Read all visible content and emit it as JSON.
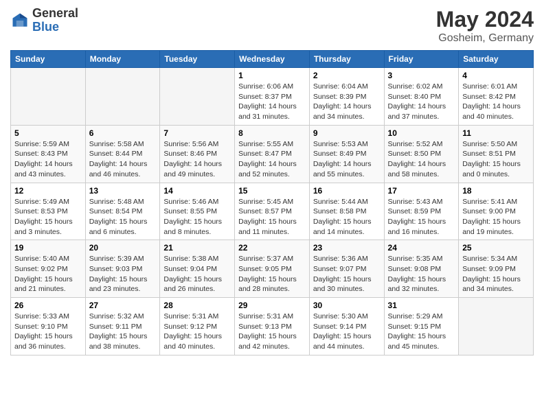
{
  "header": {
    "logo_general": "General",
    "logo_blue": "Blue",
    "month": "May 2024",
    "location": "Gosheim, Germany"
  },
  "days_of_week": [
    "Sunday",
    "Monday",
    "Tuesday",
    "Wednesday",
    "Thursday",
    "Friday",
    "Saturday"
  ],
  "weeks": [
    [
      {
        "day": "",
        "info": ""
      },
      {
        "day": "",
        "info": ""
      },
      {
        "day": "",
        "info": ""
      },
      {
        "day": "1",
        "info": "Sunrise: 6:06 AM\nSunset: 8:37 PM\nDaylight: 14 hours\nand 31 minutes."
      },
      {
        "day": "2",
        "info": "Sunrise: 6:04 AM\nSunset: 8:39 PM\nDaylight: 14 hours\nand 34 minutes."
      },
      {
        "day": "3",
        "info": "Sunrise: 6:02 AM\nSunset: 8:40 PM\nDaylight: 14 hours\nand 37 minutes."
      },
      {
        "day": "4",
        "info": "Sunrise: 6:01 AM\nSunset: 8:42 PM\nDaylight: 14 hours\nand 40 minutes."
      }
    ],
    [
      {
        "day": "5",
        "info": "Sunrise: 5:59 AM\nSunset: 8:43 PM\nDaylight: 14 hours\nand 43 minutes."
      },
      {
        "day": "6",
        "info": "Sunrise: 5:58 AM\nSunset: 8:44 PM\nDaylight: 14 hours\nand 46 minutes."
      },
      {
        "day": "7",
        "info": "Sunrise: 5:56 AM\nSunset: 8:46 PM\nDaylight: 14 hours\nand 49 minutes."
      },
      {
        "day": "8",
        "info": "Sunrise: 5:55 AM\nSunset: 8:47 PM\nDaylight: 14 hours\nand 52 minutes."
      },
      {
        "day": "9",
        "info": "Sunrise: 5:53 AM\nSunset: 8:49 PM\nDaylight: 14 hours\nand 55 minutes."
      },
      {
        "day": "10",
        "info": "Sunrise: 5:52 AM\nSunset: 8:50 PM\nDaylight: 14 hours\nand 58 minutes."
      },
      {
        "day": "11",
        "info": "Sunrise: 5:50 AM\nSunset: 8:51 PM\nDaylight: 15 hours\nand 0 minutes."
      }
    ],
    [
      {
        "day": "12",
        "info": "Sunrise: 5:49 AM\nSunset: 8:53 PM\nDaylight: 15 hours\nand 3 minutes."
      },
      {
        "day": "13",
        "info": "Sunrise: 5:48 AM\nSunset: 8:54 PM\nDaylight: 15 hours\nand 6 minutes."
      },
      {
        "day": "14",
        "info": "Sunrise: 5:46 AM\nSunset: 8:55 PM\nDaylight: 15 hours\nand 8 minutes."
      },
      {
        "day": "15",
        "info": "Sunrise: 5:45 AM\nSunset: 8:57 PM\nDaylight: 15 hours\nand 11 minutes."
      },
      {
        "day": "16",
        "info": "Sunrise: 5:44 AM\nSunset: 8:58 PM\nDaylight: 15 hours\nand 14 minutes."
      },
      {
        "day": "17",
        "info": "Sunrise: 5:43 AM\nSunset: 8:59 PM\nDaylight: 15 hours\nand 16 minutes."
      },
      {
        "day": "18",
        "info": "Sunrise: 5:41 AM\nSunset: 9:00 PM\nDaylight: 15 hours\nand 19 minutes."
      }
    ],
    [
      {
        "day": "19",
        "info": "Sunrise: 5:40 AM\nSunset: 9:02 PM\nDaylight: 15 hours\nand 21 minutes."
      },
      {
        "day": "20",
        "info": "Sunrise: 5:39 AM\nSunset: 9:03 PM\nDaylight: 15 hours\nand 23 minutes."
      },
      {
        "day": "21",
        "info": "Sunrise: 5:38 AM\nSunset: 9:04 PM\nDaylight: 15 hours\nand 26 minutes."
      },
      {
        "day": "22",
        "info": "Sunrise: 5:37 AM\nSunset: 9:05 PM\nDaylight: 15 hours\nand 28 minutes."
      },
      {
        "day": "23",
        "info": "Sunrise: 5:36 AM\nSunset: 9:07 PM\nDaylight: 15 hours\nand 30 minutes."
      },
      {
        "day": "24",
        "info": "Sunrise: 5:35 AM\nSunset: 9:08 PM\nDaylight: 15 hours\nand 32 minutes."
      },
      {
        "day": "25",
        "info": "Sunrise: 5:34 AM\nSunset: 9:09 PM\nDaylight: 15 hours\nand 34 minutes."
      }
    ],
    [
      {
        "day": "26",
        "info": "Sunrise: 5:33 AM\nSunset: 9:10 PM\nDaylight: 15 hours\nand 36 minutes."
      },
      {
        "day": "27",
        "info": "Sunrise: 5:32 AM\nSunset: 9:11 PM\nDaylight: 15 hours\nand 38 minutes."
      },
      {
        "day": "28",
        "info": "Sunrise: 5:31 AM\nSunset: 9:12 PM\nDaylight: 15 hours\nand 40 minutes."
      },
      {
        "day": "29",
        "info": "Sunrise: 5:31 AM\nSunset: 9:13 PM\nDaylight: 15 hours\nand 42 minutes."
      },
      {
        "day": "30",
        "info": "Sunrise: 5:30 AM\nSunset: 9:14 PM\nDaylight: 15 hours\nand 44 minutes."
      },
      {
        "day": "31",
        "info": "Sunrise: 5:29 AM\nSunset: 9:15 PM\nDaylight: 15 hours\nand 45 minutes."
      },
      {
        "day": "",
        "info": ""
      }
    ]
  ]
}
